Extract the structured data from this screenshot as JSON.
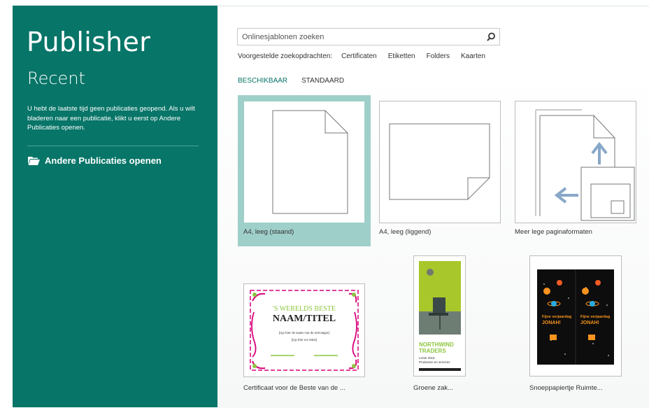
{
  "app": {
    "title": "Publisher"
  },
  "left": {
    "recent_title": "Recent",
    "recent_description": "U hebt de laatste tijd geen publicaties geopend. Als u wilt bladeren naar een publicatie, klikt u eerst op Andere Publicaties openen.",
    "open_other_label": "Andere Publicaties openen",
    "open_other_icon": "folder-open-icon"
  },
  "search": {
    "placeholder": "Onlinesjablonen zoeken",
    "icon": "search-icon",
    "suggestions_label": "Voorgestelde zoekopdrachten:",
    "suggestions": [
      "Certificaten",
      "Etiketten",
      "Folders",
      "Kaarten"
    ]
  },
  "tabs": [
    {
      "label": "BESCHIKBAAR",
      "active": true
    },
    {
      "label": "STANDAARD",
      "active": false
    }
  ],
  "templates": [
    {
      "caption": "A4, leeg (staand)",
      "selected": true
    },
    {
      "caption": "A4, leeg (liggend)",
      "selected": false
    },
    {
      "caption": "Meer lege paginaformaten",
      "selected": false
    },
    {
      "caption": "Certificaat voor de Beste van de ...",
      "preview": {
        "heading": "'S WERELDS BESTE",
        "title": "NAAM/TITEL",
        "line1": "[typ hier de naam van de ontvanger]",
        "line2": "[typ hier uw tekst]"
      }
    },
    {
      "caption": "Groene zak...",
      "preview": {
        "brand_line1": "NORTHWIND",
        "brand_line2": "TRADERS",
        "sub1": "Lente 2016",
        "sub2": "Producten en services"
      }
    },
    {
      "caption": "Snoeppapiertje Ruimte...",
      "preview": {
        "text1": "Fijne verjaardag",
        "text2": "JONAH!"
      }
    }
  ],
  "colors": {
    "accent": "#077568",
    "selected_tile": "#9fcfc9",
    "certificate_pink": "#d9007a",
    "certificate_green": "#8cc63f",
    "northwind_green": "#8dc63f",
    "space_bg": "#0d0d0d",
    "space_orange": "#f7931e"
  }
}
